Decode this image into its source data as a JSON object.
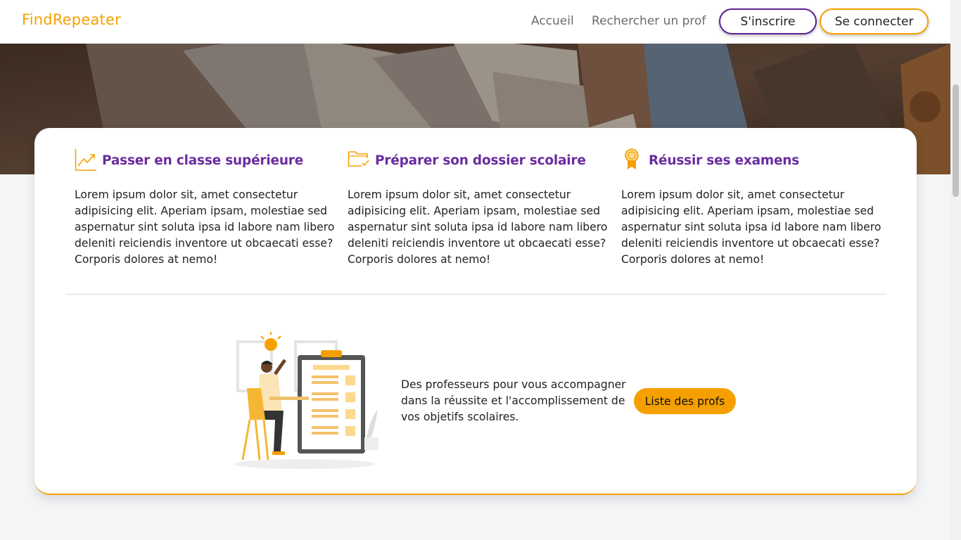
{
  "navbar": {
    "brand": "FindRepeater",
    "links": {
      "home": "Accueil",
      "search": "Rechercher un prof"
    },
    "buttons": {
      "signup": "S'inscrire",
      "login": "Se connecter"
    }
  },
  "features": [
    {
      "icon": "trending-up-icon",
      "title": "Passer en classe supérieure",
      "text": "Lorem ipsum dolor sit, amet consectetur adipisicing elit. Aperiam ipsam, molestiae sed aspernatur sint soluta ipsa id labore nam libero deleniti reiciendis inventore ut obcaecati esse? Corporis dolores at nemo!"
    },
    {
      "icon": "folder-check-icon",
      "title": "Préparer son dossier scolaire",
      "text": "Lorem ipsum dolor sit, amet consectetur adipisicing elit. Aperiam ipsam, molestiae sed aspernatur sint soluta ipsa id labore nam libero deleniti reiciendis inventore ut obcaecati esse? Corporis dolores at nemo!"
    },
    {
      "icon": "award-medal-icon",
      "title": "Réussir ses examens",
      "text": "Lorem ipsum dolor sit, amet consectetur adipisicing elit. Aperiam ipsam, molestiae sed aspernatur sint soluta ipsa id labore nam libero deleniti reiciendis inventore ut obcaecati esse? Corporis dolores at nemo!"
    }
  ],
  "cta": {
    "text": "Des professeurs pour vous accompagner dans la réussite et l'accomplissement de vos objetifs scolaires.",
    "button": "Liste des profs"
  },
  "colors": {
    "accent": "#f5a000",
    "brand_purple": "#6a2c9f",
    "signup_border": "#5b2193"
  }
}
